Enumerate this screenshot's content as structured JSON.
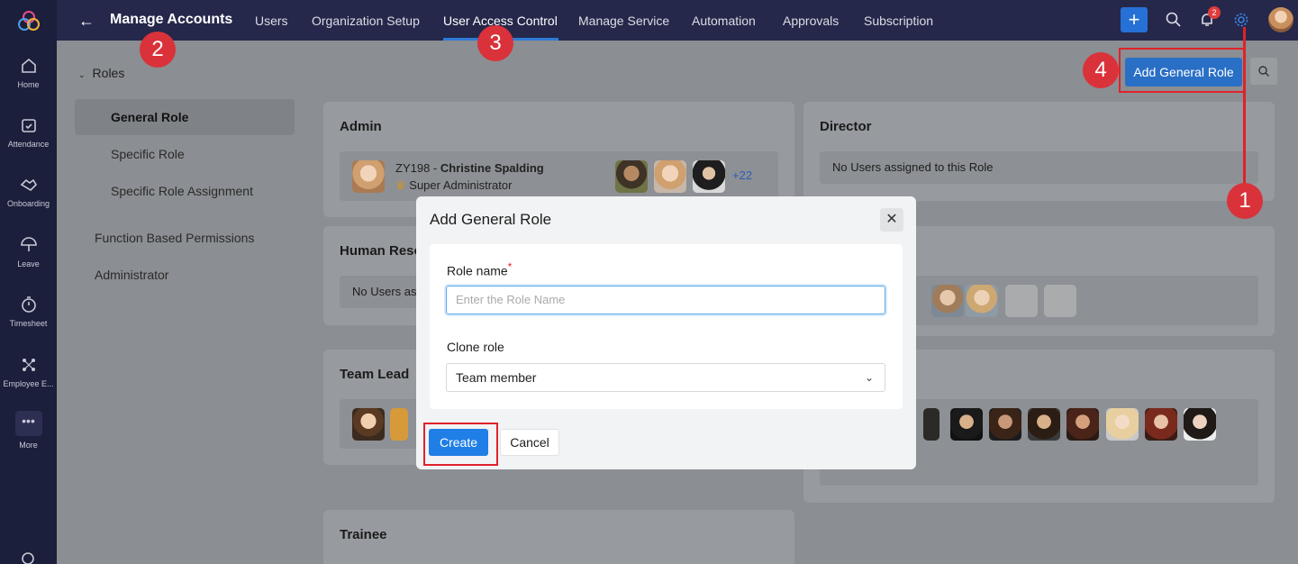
{
  "rail": {
    "items": [
      {
        "label": "Home"
      },
      {
        "label": "Attendance"
      },
      {
        "label": "Onboarding"
      },
      {
        "label": "Leave"
      },
      {
        "label": "Timesheet"
      },
      {
        "label": "Employee E..."
      },
      {
        "label": "More"
      }
    ]
  },
  "topbar": {
    "title": "Manage Accounts",
    "nav": [
      "Users",
      "Organization Setup",
      "User Access Control",
      "Manage Service",
      "Automation",
      "Approvals",
      "Subscription"
    ],
    "active_nav": "User Access Control",
    "notification_count": "2"
  },
  "sidebar": {
    "section_title": "Roles",
    "items": [
      "General Role",
      "Specific Role",
      "Specific Role Assignment"
    ],
    "selected": "General Role",
    "other_items": [
      "Function Based Permissions",
      "Administrator"
    ]
  },
  "actions": {
    "add_general_role": "Add General Role"
  },
  "cards": {
    "admin": {
      "title": "Admin",
      "user_id": "ZY198 - ",
      "user_name": "Christine Spalding",
      "user_role": "Super Administrator",
      "more_count": "+22"
    },
    "director": {
      "title": "Director",
      "empty": "No Users assigned to this Role"
    },
    "hr": {
      "title": "Human Reso",
      "empty": "No Users ass"
    },
    "team_lead": {
      "title": "Team Lead"
    },
    "trainee": {
      "title": "Trainee"
    }
  },
  "modal": {
    "title": "Add General Role",
    "role_name_label": "Role name",
    "required_mark": "*",
    "role_name_placeholder": "Enter the Role Name",
    "clone_label": "Clone role",
    "clone_value": "Team member",
    "create": "Create",
    "cancel": "Cancel"
  },
  "markers": [
    "1",
    "2",
    "3",
    "4"
  ],
  "colors": {
    "accent": "#1f7fe6",
    "annotation_red": "#e0222a",
    "sidebar_bg": "#1c1f3b",
    "topbar_bg": "#25284a"
  }
}
